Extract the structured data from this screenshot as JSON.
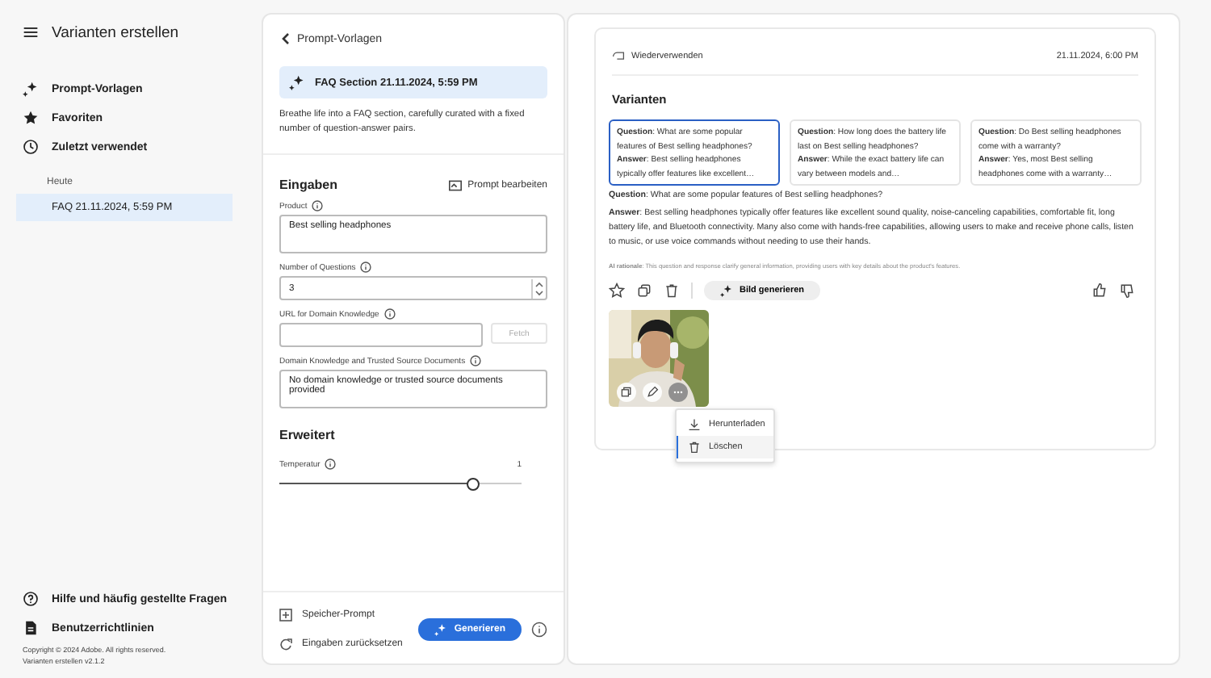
{
  "app_title": "Varianten erstellen",
  "sidebar": {
    "items": [
      {
        "label": "Prompt-Vorlagen"
      },
      {
        "label": "Favoriten"
      },
      {
        "label": "Zuletzt verwendet"
      }
    ],
    "group_label": "Heute",
    "history": [
      {
        "label": "FAQ 21.11.2024, 5:59 PM",
        "selected": true
      }
    ],
    "footer_items": [
      {
        "label": "Hilfe und häufig gestellte Fragen"
      },
      {
        "label": "Benutzerrichtlinien"
      }
    ],
    "copyright": "Copyright © 2024 Adobe. All rights reserved.",
    "version": "Varianten erstellen v2.1.2"
  },
  "template_panel": {
    "back_label": "Prompt-Vorlagen",
    "template_title": "FAQ Section 21.11.2024, 5:59 PM",
    "description": "Breathe life into a FAQ section, carefully curated with a fixed number of question-answer pairs.",
    "inputs_heading": "Eingaben",
    "edit_prompt": "Prompt bearbeiten",
    "fields": [
      {
        "kind": "textarea",
        "label": "Product",
        "value": "Best selling headphones"
      },
      {
        "kind": "number",
        "label": "Number of Questions",
        "value": "3"
      },
      {
        "kind": "url",
        "label": "URL for Domain Knowledge",
        "button": "Fetch"
      },
      {
        "kind": "textarea",
        "label": "Domain Knowledge and Trusted Source Documents",
        "value": "No domain knowledge or trusted source documents provided"
      }
    ],
    "advanced_heading": "Erweitert",
    "slider": {
      "label": "Temperatur",
      "reading": "1",
      "level": 0.8
    },
    "save_prompt": "Speicher-Prompt",
    "reset_inputs": "Eingaben zurücksetzen",
    "generate": "Generieren"
  },
  "result": {
    "reuse": "Wiederverwenden",
    "timestamp": "21.11.2024, 6:00 PM",
    "variants_heading": "Varianten",
    "variants": [
      {
        "question": "**Question**: What are some popular features of Best selling headphones?",
        "answer": "**Answer**: Best selling headphones typically offer features like excellent…",
        "selected": true
      },
      {
        "question": "**Question**: How long does the battery life last on Best selling headphones?",
        "answer": "**Answer**: While the exact battery life can vary between models and…",
        "selected": false
      },
      {
        "question": "**Question**: Do Best selling headphones come with a warranty?",
        "answer": "**Answer**: Yes, most Best selling headphones come with a warranty…",
        "selected": false
      }
    ],
    "detail_question": "**Question**: What are some popular features of Best selling headphones?",
    "detail_answer": "**Answer**: Best selling headphones typically offer features like excellent sound quality, noise-canceling capabilities, comfortable fit, long battery life, and Bluetooth connectivity. Many also come with hands-free capabilities, allowing users to make and receive phone calls, listen to music, or use voice commands without needing to use their hands.",
    "rationale": "**AI rationale**: This question and response clarify general information, providing users with key details about the product's features.",
    "generate_image": "Bild generieren",
    "menu": [
      {
        "label": "Herunterladen",
        "selected": false
      },
      {
        "label": "Löschen",
        "selected": true
      }
    ]
  }
}
